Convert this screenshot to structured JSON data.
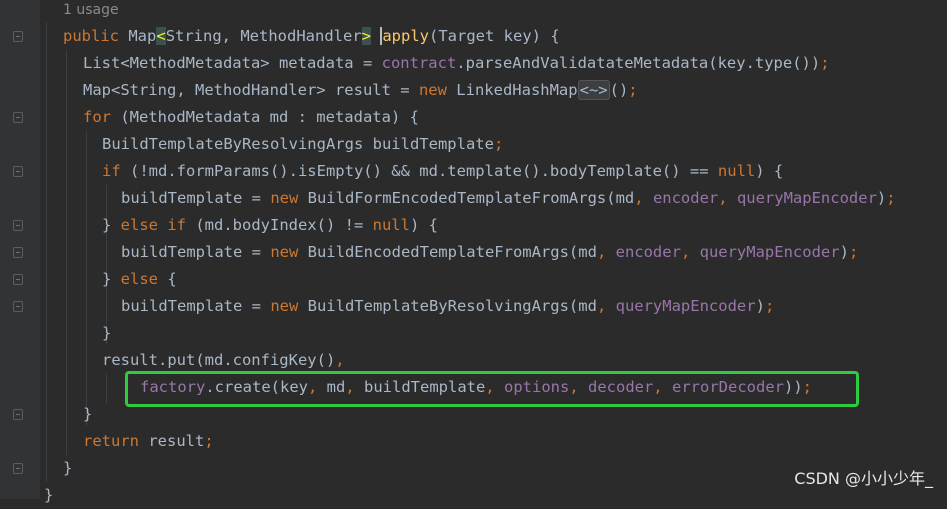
{
  "editor": {
    "usage_hint": "1 usage",
    "code": {
      "l1": {
        "kw": "public",
        "t1": "Map",
        "b1": "<",
        "t2": "String, MethodHandler",
        "b2": ">",
        "m": "apply",
        "t3": "(Target key) {"
      },
      "l2": {
        "t1": "List<MethodMetadata> metadata = ",
        "f": "contract",
        "t2": ".parseAndValidatateMetadata(key.type())",
        "s": ";"
      },
      "l3": {
        "t1": "Map<String, MethodHandler> result = ",
        "kw": "new",
        "t2": " LinkedHashMap",
        "d": "<~>",
        "t3": "()",
        "s": ";"
      },
      "l4": {
        "kw": "for",
        "t1": " (MethodMetadata md : metadata) {"
      },
      "l5": {
        "t1": "BuildTemplateByResolvingArgs buildTemplate",
        "s": ";"
      },
      "l6": {
        "kw": "if",
        "t1": " (!md.formParams().isEmpty() && md.template().bodyTemplate() == ",
        "kw2": "null",
        "t2": ") {"
      },
      "l7": {
        "t1": "buildTemplate = ",
        "kw": "new",
        "t2": " BuildFormEncodedTemplateFromArgs(md",
        "s1": ", ",
        "f1": "encoder",
        "s2": ", ",
        "f2": "queryMapEncoder",
        "t3": ")",
        "s3": ";"
      },
      "l8": {
        "t1": "} ",
        "kw": "else if",
        "t2": " (md.bodyIndex() != ",
        "kw2": "null",
        "t3": ") {"
      },
      "l9": {
        "t1": "buildTemplate = ",
        "kw": "new",
        "t2": " BuildEncodedTemplateFromArgs(md",
        "s1": ", ",
        "f1": "encoder",
        "s2": ", ",
        "f2": "queryMapEncoder",
        "t3": ")",
        "s3": ";"
      },
      "l10": {
        "t1": "} ",
        "kw": "else",
        "t2": " {"
      },
      "l11": {
        "t1": "buildTemplate = ",
        "kw": "new",
        "t2": " BuildTemplateByResolvingArgs(md",
        "s1": ", ",
        "f1": "queryMapEncoder",
        "t3": ")",
        "s2": ";"
      },
      "l12": {
        "t1": "}"
      },
      "l13": {
        "t1": "result.put(md.configKey()",
        "s": ","
      },
      "l14": {
        "f1": "factory",
        "t1": ".create(key",
        "s1": ", ",
        "t2": "md",
        "s2": ", ",
        "t3": "buildTemplate",
        "s3": ", ",
        "f2": "options",
        "s4": ", ",
        "f3": "decoder",
        "s5": ", ",
        "f4": "errorDecoder",
        "t4": "))",
        "s6": ";"
      },
      "l15": {
        "t1": "}"
      },
      "l16": {
        "kw": "return",
        "t1": " result",
        "s": ";"
      },
      "l17": {
        "t1": "}"
      },
      "l18": {
        "t1": "}"
      }
    }
  },
  "watermark": "CSDN @小小少年_",
  "colors": {
    "keyword": "#cc7832",
    "field": "#9876aa",
    "method": "#ffc66d",
    "text": "#a9b7c6",
    "background": "#2b2b2b",
    "highlight_box": "#2ecc40"
  }
}
